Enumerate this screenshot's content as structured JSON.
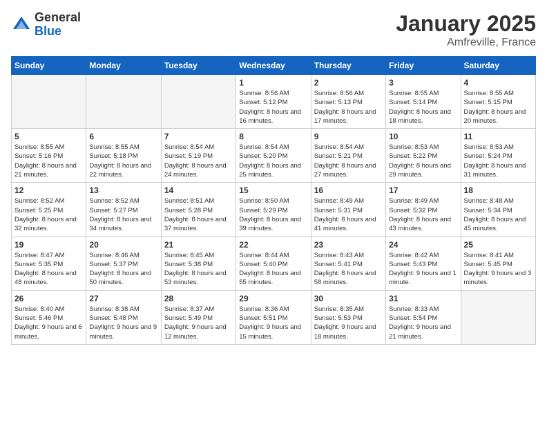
{
  "logo": {
    "general": "General",
    "blue": "Blue"
  },
  "header": {
    "title": "January 2025",
    "subtitle": "Amfreville, France"
  },
  "weekdays": [
    "Sunday",
    "Monday",
    "Tuesday",
    "Wednesday",
    "Thursday",
    "Friday",
    "Saturday"
  ],
  "weeks": [
    [
      {
        "day": "",
        "empty": true
      },
      {
        "day": "",
        "empty": true
      },
      {
        "day": "",
        "empty": true
      },
      {
        "day": "1",
        "sunrise": "8:56 AM",
        "sunset": "5:12 PM",
        "daylight": "8 hours and 16 minutes."
      },
      {
        "day": "2",
        "sunrise": "8:56 AM",
        "sunset": "5:13 PM",
        "daylight": "8 hours and 17 minutes."
      },
      {
        "day": "3",
        "sunrise": "8:55 AM",
        "sunset": "5:14 PM",
        "daylight": "8 hours and 18 minutes."
      },
      {
        "day": "4",
        "sunrise": "8:55 AM",
        "sunset": "5:15 PM",
        "daylight": "8 hours and 20 minutes."
      }
    ],
    [
      {
        "day": "5",
        "sunrise": "8:55 AM",
        "sunset": "5:16 PM",
        "daylight": "8 hours and 21 minutes."
      },
      {
        "day": "6",
        "sunrise": "8:55 AM",
        "sunset": "5:18 PM",
        "daylight": "8 hours and 22 minutes."
      },
      {
        "day": "7",
        "sunrise": "8:54 AM",
        "sunset": "5:19 PM",
        "daylight": "8 hours and 24 minutes."
      },
      {
        "day": "8",
        "sunrise": "8:54 AM",
        "sunset": "5:20 PM",
        "daylight": "8 hours and 25 minutes."
      },
      {
        "day": "9",
        "sunrise": "8:54 AM",
        "sunset": "5:21 PM",
        "daylight": "8 hours and 27 minutes."
      },
      {
        "day": "10",
        "sunrise": "8:53 AM",
        "sunset": "5:22 PM",
        "daylight": "8 hours and 29 minutes."
      },
      {
        "day": "11",
        "sunrise": "8:53 AM",
        "sunset": "5:24 PM",
        "daylight": "8 hours and 31 minutes."
      }
    ],
    [
      {
        "day": "12",
        "sunrise": "8:52 AM",
        "sunset": "5:25 PM",
        "daylight": "8 hours and 32 minutes."
      },
      {
        "day": "13",
        "sunrise": "8:52 AM",
        "sunset": "5:27 PM",
        "daylight": "8 hours and 34 minutes."
      },
      {
        "day": "14",
        "sunrise": "8:51 AM",
        "sunset": "5:28 PM",
        "daylight": "8 hours and 37 minutes."
      },
      {
        "day": "15",
        "sunrise": "8:50 AM",
        "sunset": "5:29 PM",
        "daylight": "8 hours and 39 minutes."
      },
      {
        "day": "16",
        "sunrise": "8:49 AM",
        "sunset": "5:31 PM",
        "daylight": "8 hours and 41 minutes."
      },
      {
        "day": "17",
        "sunrise": "8:49 AM",
        "sunset": "5:32 PM",
        "daylight": "8 hours and 43 minutes."
      },
      {
        "day": "18",
        "sunrise": "8:48 AM",
        "sunset": "5:34 PM",
        "daylight": "8 hours and 45 minutes."
      }
    ],
    [
      {
        "day": "19",
        "sunrise": "8:47 AM",
        "sunset": "5:35 PM",
        "daylight": "8 hours and 48 minutes."
      },
      {
        "day": "20",
        "sunrise": "8:46 AM",
        "sunset": "5:37 PM",
        "daylight": "8 hours and 50 minutes."
      },
      {
        "day": "21",
        "sunrise": "8:45 AM",
        "sunset": "5:38 PM",
        "daylight": "8 hours and 53 minutes."
      },
      {
        "day": "22",
        "sunrise": "8:44 AM",
        "sunset": "5:40 PM",
        "daylight": "8 hours and 55 minutes."
      },
      {
        "day": "23",
        "sunrise": "8:43 AM",
        "sunset": "5:41 PM",
        "daylight": "8 hours and 58 minutes."
      },
      {
        "day": "24",
        "sunrise": "8:42 AM",
        "sunset": "5:43 PM",
        "daylight": "9 hours and 1 minute."
      },
      {
        "day": "25",
        "sunrise": "8:41 AM",
        "sunset": "5:45 PM",
        "daylight": "9 hours and 3 minutes."
      }
    ],
    [
      {
        "day": "26",
        "sunrise": "8:40 AM",
        "sunset": "5:46 PM",
        "daylight": "9 hours and 6 minutes."
      },
      {
        "day": "27",
        "sunrise": "8:38 AM",
        "sunset": "5:48 PM",
        "daylight": "9 hours and 9 minutes."
      },
      {
        "day": "28",
        "sunrise": "8:37 AM",
        "sunset": "5:49 PM",
        "daylight": "9 hours and 12 minutes."
      },
      {
        "day": "29",
        "sunrise": "8:36 AM",
        "sunset": "5:51 PM",
        "daylight": "9 hours and 15 minutes."
      },
      {
        "day": "30",
        "sunrise": "8:35 AM",
        "sunset": "5:53 PM",
        "daylight": "9 hours and 18 minutes."
      },
      {
        "day": "31",
        "sunrise": "8:33 AM",
        "sunset": "5:54 PM",
        "daylight": "9 hours and 21 minutes."
      },
      {
        "day": "",
        "empty": true
      }
    ]
  ],
  "labels": {
    "sunrise": "Sunrise:",
    "sunset": "Sunset:",
    "daylight": "Daylight:"
  }
}
